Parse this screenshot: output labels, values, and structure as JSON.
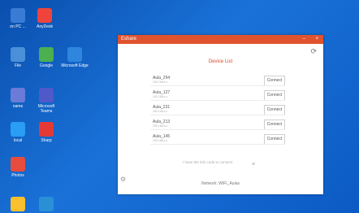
{
  "desktop": {
    "icons": [
      {
        "label": "on PC ...",
        "color": "#3a7bd5"
      },
      {
        "label": "AnyDesk",
        "color": "#ef443b"
      },
      {
        "label": "File",
        "color": "#4a90d9"
      },
      {
        "label": "Google",
        "color": "#4caf50"
      },
      {
        "label": "Microsoft Edge",
        "color": "#2e86de"
      },
      {
        "label": "name",
        "color": "#6b7bd8"
      },
      {
        "label": "Microsoft Teams",
        "color": "#5059c9"
      },
      {
        "label": "local",
        "color": "#2a9df4"
      },
      {
        "label": "Sharp",
        "color": "#e53935"
      },
      {
        "label": "Photos",
        "color": "#e84c3d"
      },
      {
        "label": "",
        "color": "#fbc02d"
      },
      {
        "label": "",
        "color": "#2b8fd6"
      }
    ]
  },
  "window": {
    "title": "Eshare",
    "minimize_icon": "minimize-icon",
    "close_icon": "close-icon",
    "refresh_icon": "refresh-icon",
    "device_list_title": "Device List",
    "devices": [
      {
        "name": "Aula_294",
        "sub": "192.168.x.x",
        "button": "Connect"
      },
      {
        "name": "Aula_127",
        "sub": "192.168.x.x",
        "button": "Connect"
      },
      {
        "name": "Aula_231",
        "sub": "192.168.x.x",
        "button": "Connect"
      },
      {
        "name": "Aula_213",
        "sub": "192.168.x.x",
        "button": "Connect"
      },
      {
        "name": "Aula_145",
        "sub": "192.168.x.x",
        "button": "Connect"
      }
    ],
    "footer_text": "I have the info code to connect",
    "footer_info_icon": "info-icon",
    "settings_icon": "gear-icon",
    "network_label": "Network: WIFI_Aulas"
  }
}
